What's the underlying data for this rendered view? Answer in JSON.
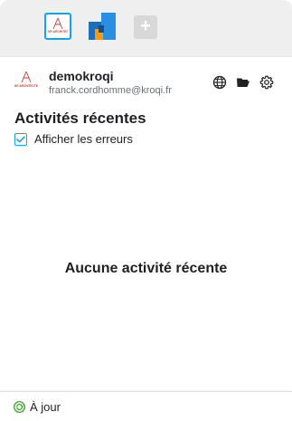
{
  "workspaces": {
    "items": [
      {
        "logo_text": "KR ARCHITECTES",
        "selected": true
      },
      {
        "logo_text": "",
        "selected": false
      }
    ],
    "add_label": "+"
  },
  "account": {
    "avatar_text": "KR ARCHITECTES",
    "name": "demokroqi",
    "email": "franck.cordhomme@kroqi.fr",
    "actions": [
      "globe-icon",
      "folder-icon",
      "gear-icon"
    ]
  },
  "activities": {
    "title": "Activités récentes",
    "show_errors_label": "Afficher les erreurs",
    "show_errors_checked": true,
    "empty_message": "Aucune activité récente"
  },
  "status": {
    "text": "À jour",
    "icon": "sync-ok-icon"
  },
  "colors": {
    "accent": "#1aa0e6",
    "brand_red": "#c23b32",
    "status_green": "#3aa62a"
  }
}
